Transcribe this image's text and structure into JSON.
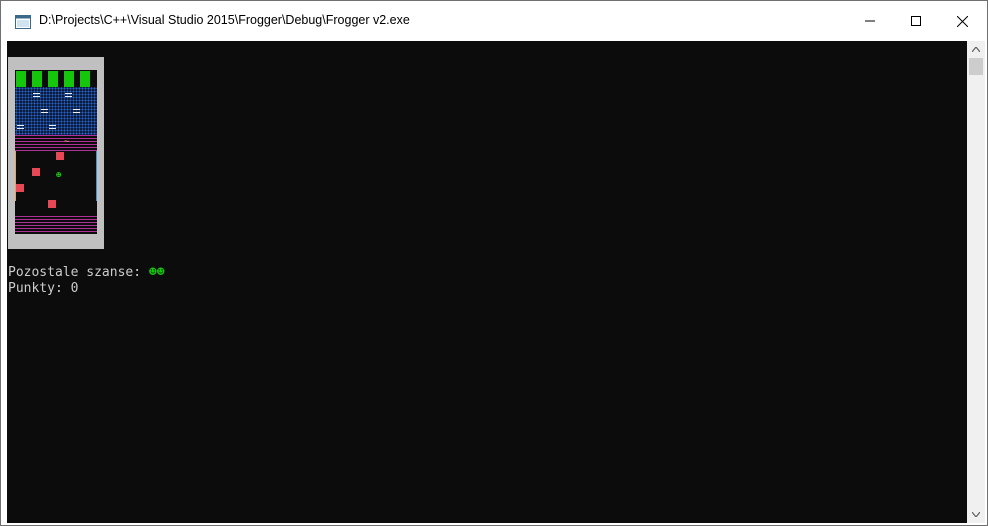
{
  "window": {
    "title": "D:\\Projects\\C++\\Visual Studio 2015\\Frogger\\Debug\\Frogger v2.exe",
    "controls": [
      "minimize-icon",
      "maximize-icon",
      "close-icon"
    ]
  },
  "console": {
    "lives_label": "Pozostale szanse: ",
    "lives_value": "☻☻",
    "score_label": "Punkty: ",
    "score_value": "0"
  },
  "game": {
    "goal_slots": 5,
    "colors": {
      "goal": "#16c60c",
      "water": "#0a1a3a",
      "log": "#f0f0f0",
      "car": "#e74856",
      "safe_zone": "#b0309a",
      "frog": "#16c60c"
    },
    "frog_glyph": "☻",
    "tilde_glyph": "~"
  },
  "colors": {
    "console_bg": "#0c0c0c",
    "console_text": "#cccccc",
    "lives_text": "#16c60c"
  }
}
